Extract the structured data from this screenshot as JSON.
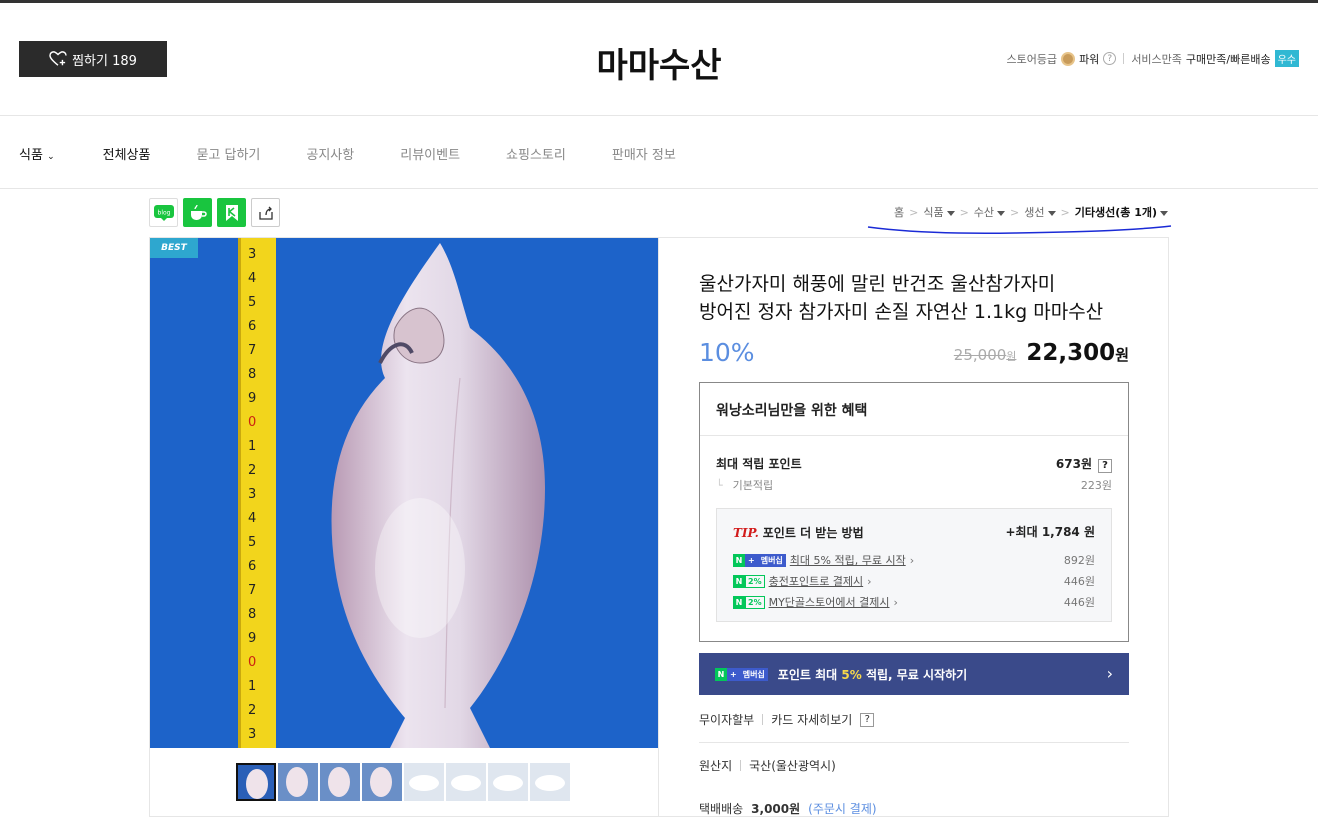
{
  "header": {
    "fav_label": "찜하기 189",
    "store_name": "마마수산",
    "grade_label": "스토어등급",
    "grade_value": "파워",
    "service_label": "서비스만족",
    "service_value": "구매만족/빠른배송",
    "service_badge": "우수"
  },
  "nav": {
    "items": [
      "식품",
      "전체상품",
      "묻고 답하기",
      "공지사항",
      "리뷰이벤트",
      "쇼핑스토리",
      "판매자 정보"
    ]
  },
  "share": {
    "blog_label": "blog"
  },
  "breadcrumb": {
    "items": [
      "홈",
      "식품",
      "수산",
      "생선"
    ],
    "last": "기타생선(총 1개)"
  },
  "image": {
    "best_badge": "BEST"
  },
  "product": {
    "title_line1": "울산가자미 해풍에 말린 반건조 울산참가자미",
    "title_line2": "방어진 정자 참가자미 손질 자연산 1.1kg 마마수산",
    "discount": "10%",
    "original_price": "25,000",
    "price": "22,300",
    "won": "원"
  },
  "benefit": {
    "title": "워낭소리님만을 위한 혜택",
    "max_point_label": "최대 적립 포인트",
    "max_point_value": "673원",
    "qmark": "?",
    "base_label": "기본적립",
    "base_value": "223원",
    "tip_prefix": "TIP.",
    "tip_title": "포인트 더 받는 방법",
    "tip_max": "+최대 1,784 원",
    "tip_rows": [
      {
        "pill": "멤버십",
        "label": "최대 5% 적립, 무료 시작",
        "value": "892원"
      },
      {
        "pill": "2%",
        "label": "충전포인트로 결제시",
        "value": "446원"
      },
      {
        "pill": "2%",
        "label": "MY단골스토어에서 결제시",
        "value": "446원"
      }
    ]
  },
  "banner": {
    "pill": "멤버십",
    "text_before": "포인트 최대",
    "pct": "5%",
    "text_after": "적립, 무료 시작하기",
    "arrow": "›"
  },
  "card": {
    "installment": "무이자할부",
    "card_detail": "카드 자세히보기",
    "qmark": "?"
  },
  "origin": {
    "label": "원산지",
    "value": "국산(울산광역시)"
  },
  "shipping": {
    "label": "택배배송",
    "price": "3,000원",
    "note": "(주문시 결제)"
  },
  "colors": {
    "accent": "#5b8ee0",
    "naver_green": "#03c75a",
    "banner": "#3a4a8a",
    "best": "#2ea7cf"
  }
}
